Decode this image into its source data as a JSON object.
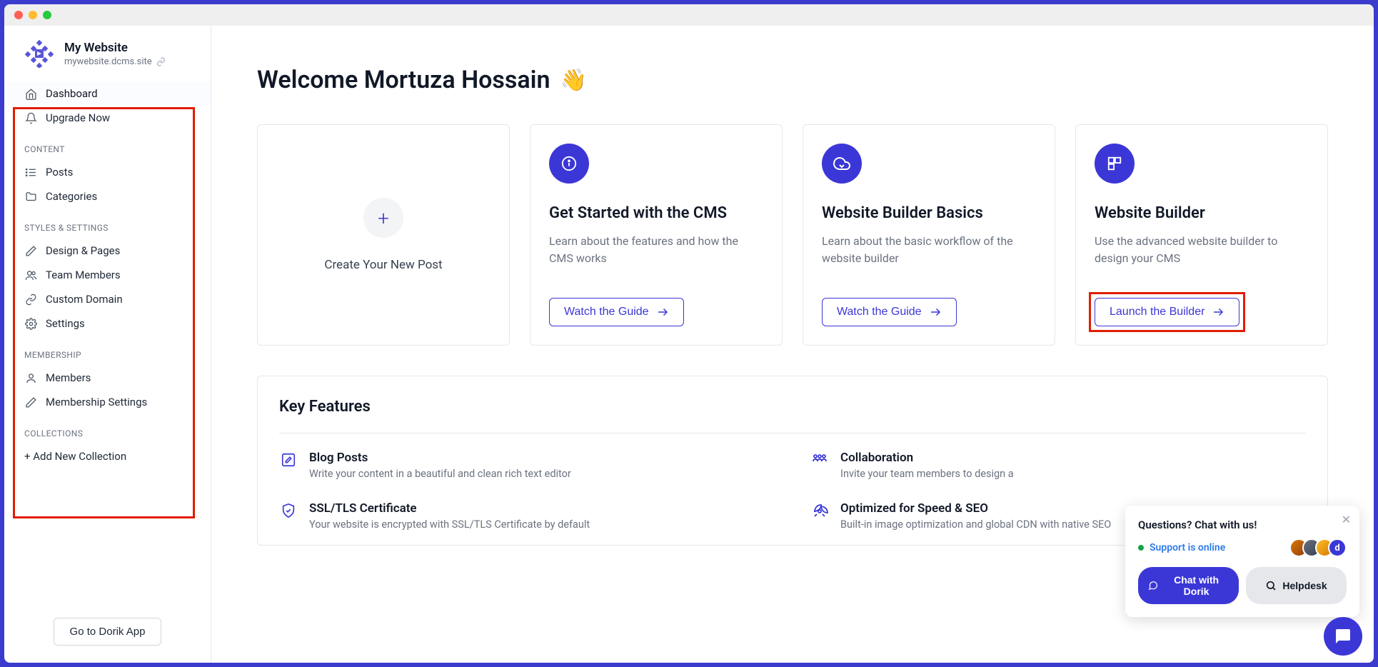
{
  "site": {
    "name": "My Website",
    "subdomain": "mywebsite.dcms.site"
  },
  "sidebar": {
    "dashboard": "Dashboard",
    "upgrade": "Upgrade Now",
    "section_content": "CONTENT",
    "posts": "Posts",
    "categories": "Categories",
    "section_styles": "STYLES & SETTINGS",
    "design": "Design & Pages",
    "team": "Team Members",
    "domain": "Custom Domain",
    "settings": "Settings",
    "section_membership": "MEMBERSHIP",
    "members": "Members",
    "membership_settings": "Membership Settings",
    "section_collections": "COLLECTIONS",
    "add_collection": "+ Add New Collection",
    "goto_app": "Go to Dorik App"
  },
  "welcome": "Welcome Mortuza Hossain",
  "cards": {
    "newpost": "Create Your New Post",
    "guide1_title": "Get Started with the CMS",
    "guide1_desc": "Learn about the features and how the CMS works",
    "guide1_btn": "Watch the Guide",
    "guide2_title": "Website Builder Basics",
    "guide2_desc": "Learn about the basic workflow of the website builder",
    "guide2_btn": "Watch the Guide",
    "builder_title": "Website Builder",
    "builder_desc": "Use the advanced website builder to design your CMS",
    "builder_btn": "Launch the Builder"
  },
  "key_features": {
    "title": "Key Features",
    "f1_title": "Blog Posts",
    "f1_desc": "Write your content in a beautiful and clean rich text editor",
    "f2_title": "Collaboration",
    "f2_desc": "Invite your team members to design a",
    "f3_title": "SSL/TLS Certificate",
    "f3_desc": "Your website is encrypted with SSL/TLS Certificate by default",
    "f4_title": "Optimized for Speed & SEO",
    "f4_desc": "Built-in image optimization and global CDN with native SEO"
  },
  "chat": {
    "title": "Questions? Chat with us!",
    "status": "Support is online",
    "btn1": "Chat with Dorik",
    "btn2": "Helpdesk"
  }
}
